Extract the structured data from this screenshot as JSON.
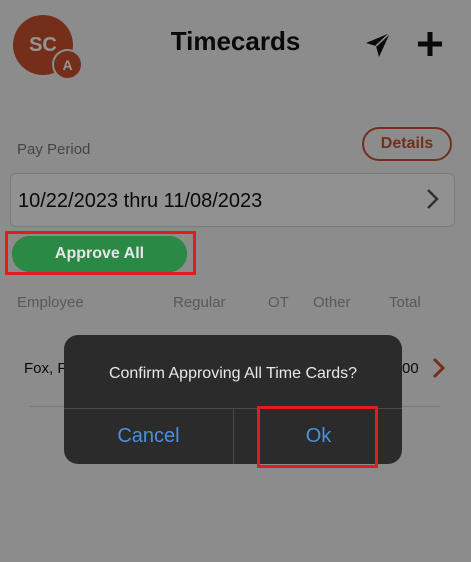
{
  "header": {
    "avatar_initials": "SC",
    "avatar_badge": "A",
    "title": "Timecards",
    "send_icon": "send-icon",
    "add_icon": "plus-icon"
  },
  "pay_period": {
    "label": "Pay Period",
    "details_label": "Details",
    "range": "10/22/2023 thru 11/08/2023"
  },
  "approve_all_label": "Approve All",
  "table": {
    "columns": [
      "Employee",
      "Regular",
      "OT",
      "Other",
      "Total"
    ],
    "rows": [
      {
        "employee": "Fox, F",
        "total": "00"
      }
    ]
  },
  "dialog": {
    "message": "Confirm Approving All Time Cards?",
    "cancel_label": "Cancel",
    "ok_label": "Ok"
  },
  "colors": {
    "accent": "#c8502e",
    "approve_green": "#2e9e4e",
    "highlight": "#e01c1c",
    "dialog_bg": "#2b2b2b",
    "dialog_button": "#4a90e2"
  }
}
